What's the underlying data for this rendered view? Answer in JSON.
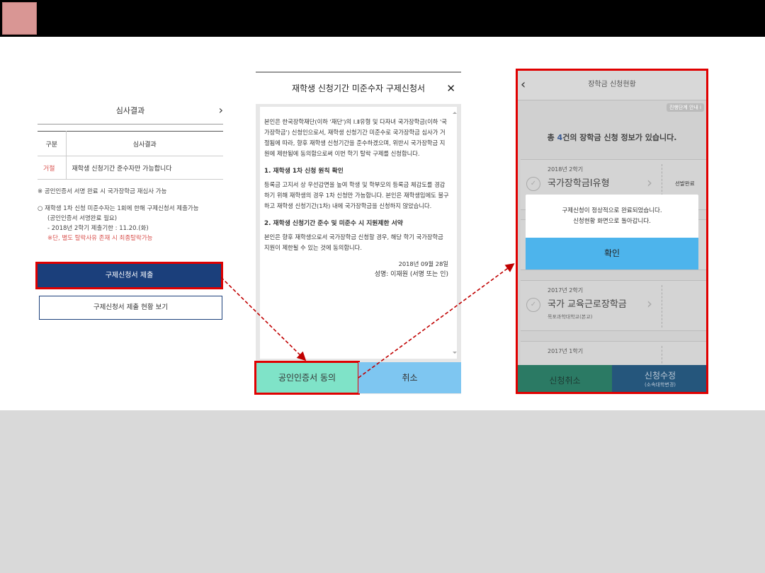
{
  "panel1": {
    "header": "심사결과",
    "table": {
      "headers": [
        "구분",
        "심사결과"
      ],
      "rows": [
        [
          "거절",
          "재학생 신청기간 준수자만 가능합니다"
        ]
      ]
    },
    "note": "※  공인인증서 서명 완료 시 국가장학금 재심사 가능",
    "list_main": "○   재학생 1차 신청 미준수자는 1회에 한해 구제신청서 제출가능",
    "list_sub1": "(공인인증서 서명완료 필요)",
    "list_sub2": "-   2018년 2학기 제출기한 : 11.20.(화)",
    "list_red": "※단, 별도 탈락사유 존재 시 최종탈락가능",
    "submit_button": "구제신청서 제출",
    "view_button": "구제신청서 제출 현황 보기"
  },
  "panel2": {
    "title": "재학생 신청기간 미준수자 구제신청서",
    "paragraph1": "본인은 한국장학재단(이하 '재단')의 Ⅰ.Ⅱ유형 및 다자녀 국가장학금(이하 '국가장학금') 신청인으로서, 재학생 신청기간 미준수로 국가장학금 심사가 거절됨에 따라, 향후 재학생 신청기간을 준수하겠으며, 위반시 국가장학금 지원에 제한됨에 동의함으로써 이번 학기 탈락 구제를 신청합니다.",
    "heading1": "1. 재학생 1차 신청 원칙 확인",
    "paragraph2": "등록금 고지서 상 우선감면을 높여 학생 및 학부모의 등록금 체감도를 경감하기 위해 재학생의 경우 1차 신청만 가능합니다. 본인은 재학생임에도 불구하고 재학생 신청기간(1차) 내에 국가장학금을 신청하지 않았습니다.",
    "heading2": "2. 재학생 신청기간 준수 및 미준수 시 지원제한 서약",
    "paragraph3": "본인은 향후 재학생으로서 국가장학금 신청할 경우, 해당 학기 국가장학금 지원이 제한될 수 있는 것에 동의합니다.",
    "date": "2018년 09월 28일",
    "signature": "성명: 이재원 (서명 또는 인)",
    "agree_button": "공인인증서 동의",
    "cancel_button": "취소"
  },
  "panel3": {
    "title": "장학금 신청현황",
    "guide_badge": "진행단계 안내 i",
    "count_pre": "총 ",
    "count_num": "4",
    "count_post": "건의 장학금 신청 정보가 있습니다.",
    "cards": [
      {
        "year": "2018년 2학기",
        "name": "국가장학금Ⅰ유형",
        "status": "선발완료",
        "school": ""
      },
      {
        "year": "2017년 2학기",
        "name": "국가 교육근로장학금",
        "status": "",
        "school": "목포과학대학교(본교)"
      },
      {
        "year": "2017년 1학기",
        "name": "",
        "status": "",
        "school": ""
      }
    ],
    "dialog_line1": "구제신청이 정상적으로 완료되었습니다.",
    "dialog_line2": "신청현황 화면으로 돌아갑니다.",
    "dialog_ok": "확인",
    "cancel_button": "신청취소",
    "edit_button": "신청수정",
    "edit_sub": "(소속대학변경)"
  }
}
